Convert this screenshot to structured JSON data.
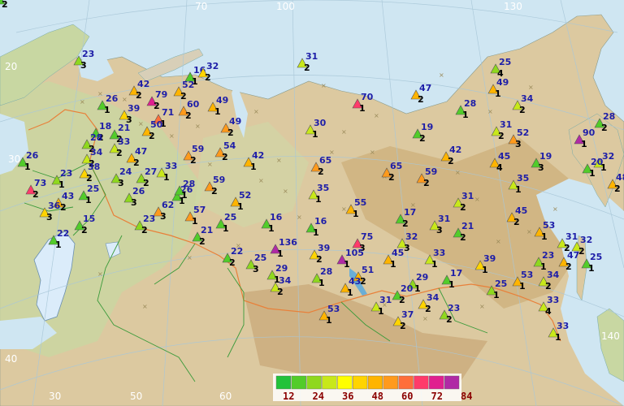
{
  "grid_labels": {
    "top": [
      "70",
      "100",
      "130"
    ],
    "left": [
      "20",
      "30"
    ],
    "right": [
      "140"
    ],
    "bottom_left": [
      "40",
      "30",
      "50",
      "60"
    ]
  },
  "legend": {
    "colors": [
      "#22c23a",
      "#52cc2a",
      "#8fd81e",
      "#c8e81a",
      "#ffff00",
      "#ffd400",
      "#ffb400",
      "#ff9a1c",
      "#ff6e3a",
      "#ff3b6a",
      "#e0208f",
      "#b02aa5"
    ],
    "labels": [
      "12",
      "24",
      "36",
      "48",
      "60",
      "72",
      "84"
    ]
  },
  "stations": [
    {
      "v": "23",
      "n": "3",
      "c": "#8fd81e"
    },
    {
      "v": "16",
      "n": "1",
      "c": "#52cc2a"
    },
    {
      "v": "32",
      "n": "2",
      "c": "#ffd400"
    },
    {
      "v": "31",
      "n": "2",
      "c": "#c8e81a"
    },
    {
      "v": "25",
      "n": "4",
      "c": "#8fd81e"
    },
    {
      "v": "49",
      "n": "1",
      "c": "#ffb400"
    },
    {
      "v": "26",
      "n": "1",
      "c": "#52cc2a"
    },
    {
      "v": "42",
      "n": "2",
      "c": "#ffb400"
    },
    {
      "v": "52",
      "n": "2",
      "c": "#ffb400"
    },
    {
      "v": "79",
      "n": "2",
      "c": "#e0208f"
    },
    {
      "v": "39",
      "n": "3",
      "c": "#ffd400"
    },
    {
      "v": "71",
      "n": "1",
      "c": "#ff6e3a"
    },
    {
      "v": "60",
      "n": "2",
      "c": "#ff9a1c"
    },
    {
      "v": "49",
      "n": "1",
      "c": "#ffb400"
    },
    {
      "v": "47",
      "n": "2",
      "c": "#ffb400"
    },
    {
      "v": "70",
      "n": "1",
      "c": "#ff3b6a"
    },
    {
      "v": "28",
      "n": "1",
      "c": "#52cc2a"
    },
    {
      "v": "34",
      "n": "2",
      "c": "#c8e81a"
    },
    {
      "v": "49",
      "n": "2",
      "c": "#ff9a1c"
    },
    {
      "v": "30",
      "n": "1",
      "c": "#c8e81a"
    },
    {
      "v": "19",
      "n": "2",
      "c": "#52cc2a"
    },
    {
      "v": "31",
      "n": "2",
      "c": "#c8e81a"
    },
    {
      "v": "52",
      "n": "3",
      "c": "#ff9a1c"
    },
    {
      "v": "90",
      "n": "1",
      "c": "#b02aa5"
    },
    {
      "v": "28",
      "n": "2",
      "c": "#52cc2a"
    },
    {
      "v": "18",
      "n": "2",
      "c": "#52cc2a"
    },
    {
      "v": "21",
      "n": "2",
      "c": "#52cc2a"
    },
    {
      "v": "50",
      "n": "2",
      "c": "#ffb400"
    },
    {
      "v": "28",
      "n": "2",
      "c": "#8fd81e"
    },
    {
      "v": "33",
      "n": "2",
      "c": "#c8e81a"
    },
    {
      "v": "34",
      "n": "2",
      "c": "#c8e81a"
    },
    {
      "v": "47",
      "n": "2",
      "c": "#ffb400"
    },
    {
      "v": "59",
      "n": "2",
      "c": "#ff9a1c"
    },
    {
      "v": "54",
      "n": "2",
      "c": "#ff9a1c"
    },
    {
      "v": "42",
      "n": "1",
      "c": "#ffb400"
    },
    {
      "v": "65",
      "n": "2",
      "c": "#ff9a1c"
    },
    {
      "v": "65",
      "n": "2",
      "c": "#ff9a1c"
    },
    {
      "v": "42",
      "n": "2",
      "c": "#ffb400"
    },
    {
      "v": "45",
      "n": "4",
      "c": "#ffb400"
    },
    {
      "v": "19",
      "n": "3",
      "c": "#52cc2a"
    },
    {
      "v": "32",
      "n": "1",
      "c": "#c8e81a"
    },
    {
      "v": "20",
      "n": "1",
      "c": "#52cc2a"
    },
    {
      "v": "38",
      "n": "2",
      "c": "#ffd400"
    },
    {
      "v": "33",
      "n": "1",
      "c": "#c8e81a"
    },
    {
      "v": "26",
      "n": "1",
      "c": "#52cc2a"
    },
    {
      "v": "23",
      "n": "1",
      "c": "#8fd81e"
    },
    {
      "v": "24",
      "n": "3",
      "c": "#8fd81e"
    },
    {
      "v": "27",
      "n": "2",
      "c": "#8fd81e"
    },
    {
      "v": "59",
      "n": "2",
      "c": "#ff9a1c"
    },
    {
      "v": "59",
      "n": "2",
      "c": "#ff9a1c"
    },
    {
      "v": "26",
      "n": "1",
      "c": "#52cc2a"
    },
    {
      "v": "35",
      "n": "1",
      "c": "#c8e81a"
    },
    {
      "v": "35",
      "n": "1",
      "c": "#c8e81a"
    },
    {
      "v": "48",
      "n": "2",
      "c": "#ffb400"
    },
    {
      "v": "73",
      "n": "2",
      "c": "#ff3b6a"
    },
    {
      "v": "25",
      "n": "1",
      "c": "#52cc2a"
    },
    {
      "v": "26",
      "n": "3",
      "c": "#8fd81e"
    },
    {
      "v": "28",
      "n": "1",
      "c": "#52cc2a"
    },
    {
      "v": "62",
      "n": "3",
      "c": "#ff9a1c"
    },
    {
      "v": "52",
      "n": "1",
      "c": "#ffb400"
    },
    {
      "v": "16",
      "n": "1",
      "c": "#52cc2a"
    },
    {
      "v": "31",
      "n": "2",
      "c": "#c8e81a"
    },
    {
      "v": "43",
      "n": "2",
      "c": "#ffb400"
    },
    {
      "v": "36",
      "n": "3",
      "c": "#ffd400"
    },
    {
      "v": "55",
      "n": "1",
      "c": "#ffb400"
    },
    {
      "v": "45",
      "n": "2",
      "c": "#ffb400"
    },
    {
      "v": "17",
      "n": "2",
      "c": "#52cc2a"
    },
    {
      "v": "31",
      "n": "3",
      "c": "#c8e81a"
    },
    {
      "v": "21",
      "n": "2",
      "c": "#52cc2a"
    },
    {
      "v": "57",
      "n": "1",
      "c": "#ff9a1c"
    },
    {
      "v": "15",
      "n": "2",
      "c": "#52cc2a"
    },
    {
      "v": "23",
      "n": "2",
      "c": "#8fd81e"
    },
    {
      "v": "25",
      "n": "1",
      "c": "#52cc2a"
    },
    {
      "v": "16",
      "n": "1",
      "c": "#52cc2a"
    },
    {
      "v": "53",
      "n": "1",
      "c": "#ffb400"
    },
    {
      "v": "21",
      "n": "2",
      "c": "#52cc2a"
    },
    {
      "v": "75",
      "n": "3",
      "c": "#ff3b6a"
    },
    {
      "v": "32",
      "n": "3",
      "c": "#c8e81a"
    },
    {
      "v": "31",
      "n": "2",
      "c": "#c8e81a"
    },
    {
      "v": "22",
      "n": "1",
      "c": "#52cc2a"
    },
    {
      "v": "32",
      "n": "2",
      "c": "#c8e81a"
    },
    {
      "v": "22",
      "n": "2",
      "c": "#52cc2a"
    },
    {
      "v": "136",
      "n": "1",
      "c": "#b02aa5"
    },
    {
      "v": "39",
      "n": "2",
      "c": "#ffd400"
    },
    {
      "v": "105",
      "n": "1",
      "c": "#b02aa5"
    },
    {
      "v": "45",
      "n": "1",
      "c": "#ffb400"
    },
    {
      "v": "33",
      "n": "1",
      "c": "#c8e81a"
    },
    {
      "v": "39",
      "n": "1",
      "c": "#ffd400"
    },
    {
      "v": "23",
      "n": "1",
      "c": "#8fd81e"
    },
    {
      "v": "47",
      "n": "2",
      "c": "#ffb400"
    },
    {
      "v": "25",
      "n": "3",
      "c": "#8fd81e"
    },
    {
      "v": "29",
      "n": "1",
      "c": "#8fd81e"
    },
    {
      "v": "28",
      "n": "1",
      "c": "#8fd81e"
    },
    {
      "v": "51",
      "n": "2",
      "c": "#ffb400"
    },
    {
      "v": "29",
      "n": "1",
      "c": "#8fd81e"
    },
    {
      "v": "17",
      "n": "1",
      "c": "#52cc2a"
    },
    {
      "v": "25",
      "n": "1",
      "c": "#8fd81e"
    },
    {
      "v": "53",
      "n": "1",
      "c": "#ffb400"
    },
    {
      "v": "34",
      "n": "2",
      "c": "#c8e81a"
    },
    {
      "v": "43",
      "n": "1",
      "c": "#ffb400"
    },
    {
      "v": "34",
      "n": "2",
      "c": "#ffd400"
    },
    {
      "v": "20",
      "n": "2",
      "c": "#52cc2a"
    },
    {
      "v": "33",
      "n": "4",
      "c": "#c8e81a"
    },
    {
      "v": "34",
      "n": "2",
      "c": "#c8e81a"
    },
    {
      "v": "53",
      "n": "1",
      "c": "#ffb400"
    },
    {
      "v": "31",
      "n": "1",
      "c": "#c8e81a"
    },
    {
      "v": "37",
      "n": "2",
      "c": "#ffd400"
    },
    {
      "v": "23",
      "n": "2",
      "c": "#8fd81e"
    },
    {
      "v": "33",
      "n": "1",
      "c": "#c8e81a"
    },
    {
      "v": "25",
      "n": "1",
      "c": "#52cc2a"
    },
    {
      "v": "25",
      "n": "2",
      "c": "#52cc2a"
    }
  ]
}
